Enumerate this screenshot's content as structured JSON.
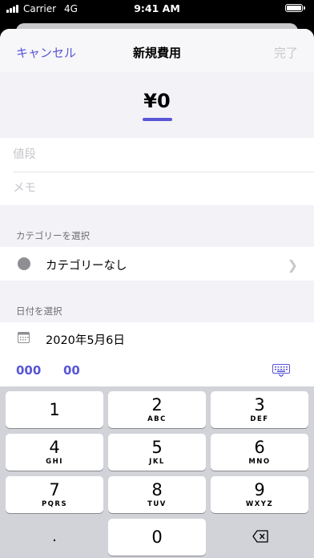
{
  "status_bar": {
    "carrier": "Carrier",
    "network": "4G",
    "time": "9:41 AM"
  },
  "nav": {
    "cancel": "キャンセル",
    "title": "新規費用",
    "done": "完了"
  },
  "amount": {
    "value": "¥0"
  },
  "inputs": {
    "price_placeholder": "値段",
    "memo_placeholder": "メモ"
  },
  "category": {
    "section_label": "カテゴリーを選択",
    "selected": "カテゴリーなし",
    "dot_color": "#8e8e93"
  },
  "date": {
    "section_label": "日付を選択",
    "value": "2020年5月6日"
  },
  "accessory": {
    "triple_zero": "000",
    "double_zero": "00"
  },
  "keypad": {
    "keys": [
      {
        "num": "1",
        "letters": ""
      },
      {
        "num": "2",
        "letters": "ABC"
      },
      {
        "num": "3",
        "letters": "DEF"
      },
      {
        "num": "4",
        "letters": "GHI"
      },
      {
        "num": "5",
        "letters": "JKL"
      },
      {
        "num": "6",
        "letters": "MNO"
      },
      {
        "num": "7",
        "letters": "PQRS"
      },
      {
        "num": "8",
        "letters": "TUV"
      },
      {
        "num": "9",
        "letters": "WXYZ"
      }
    ],
    "decimal": ".",
    "zero": "0"
  },
  "colors": {
    "accent": "#5856d6",
    "disabled": "#c7c7cc",
    "background": "#f2f2f7"
  }
}
